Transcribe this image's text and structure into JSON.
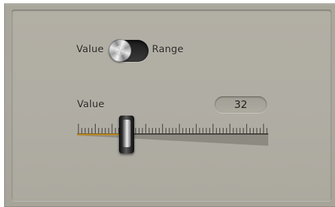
{
  "mode_toggle": {
    "left_label": "Value",
    "right_label": "Range",
    "state": "Value"
  },
  "value_slider": {
    "label": "Value",
    "value": "32",
    "position_fraction": 0.26
  },
  "colors": {
    "panel": "#aaa79e",
    "fill_accent": "#c98f12",
    "thumb": "#1b1b1b"
  }
}
